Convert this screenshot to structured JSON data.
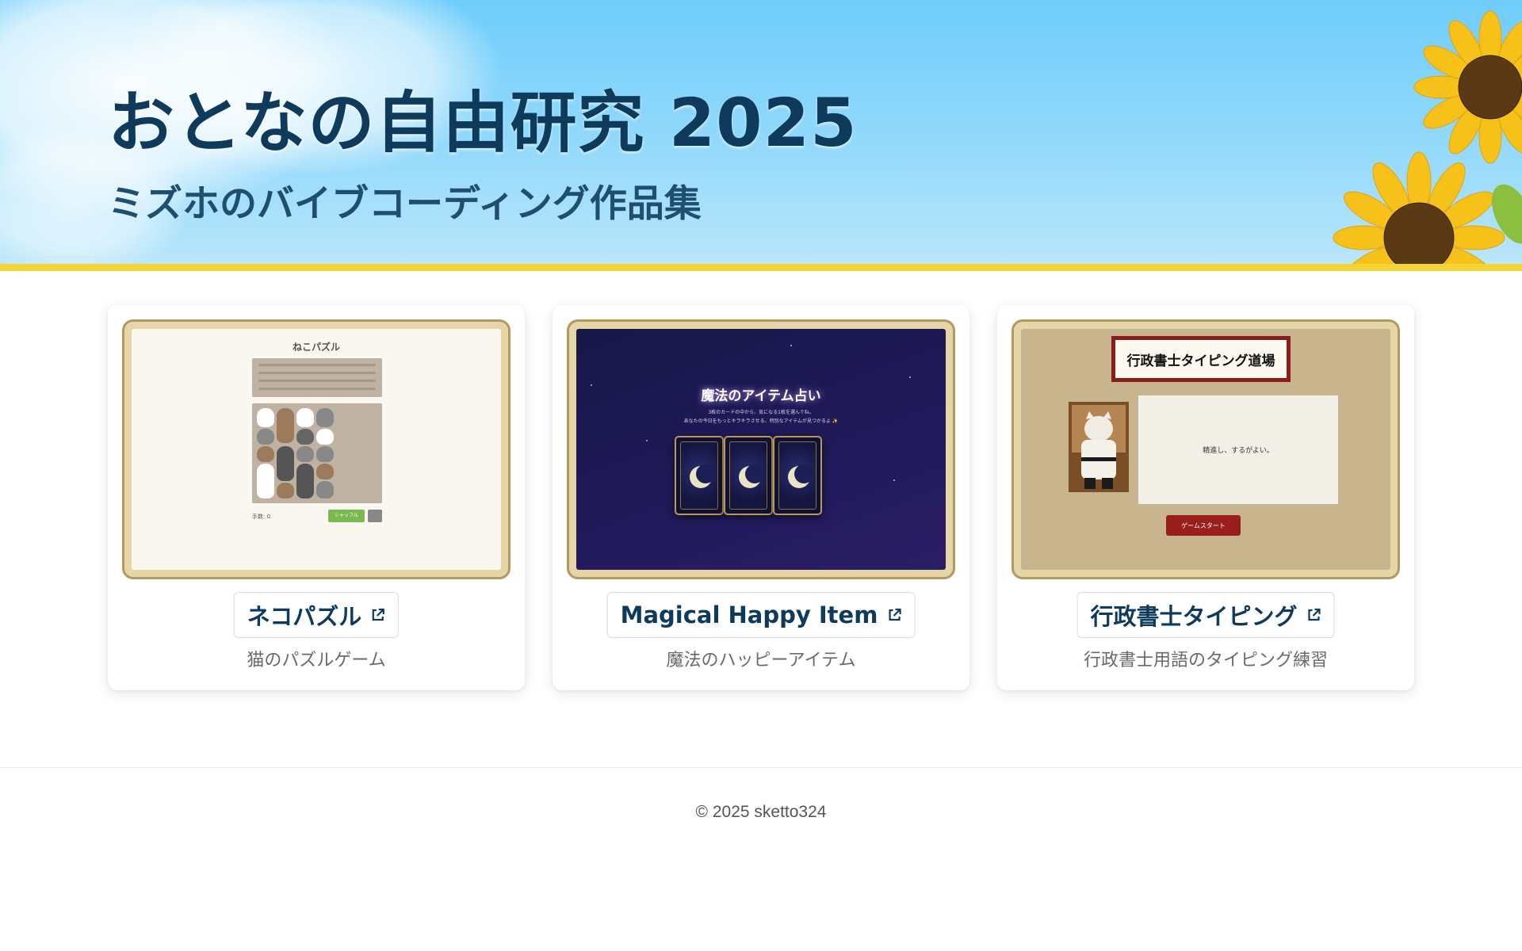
{
  "hero": {
    "title": "おとなの自由研究 2025",
    "subtitle": "ミズホのバイブコーディング作品集"
  },
  "colors": {
    "sky": "#7fd3fb",
    "stripe": "#f3d534",
    "title": "#0e3a5c",
    "frame": "#b09a62"
  },
  "cards": [
    {
      "label": "ネコパズル",
      "description": "猫のパズルゲーム",
      "icon": "external-link-icon",
      "preview": {
        "title": "ねこパズル",
        "moves_label": "手数: 0",
        "shuffle_label": "シャッフル"
      }
    },
    {
      "label": "Magical Happy Item",
      "description": "魔法のハッピーアイテム",
      "icon": "external-link-icon",
      "preview": {
        "title": "魔法のアイテム占い",
        "line1": "3枚のカードの中から、気になる1枚を選んでね。",
        "line2": "あなたの今日をもっとキラキラさせる、特別なアイテムが見つかるよ ✨"
      }
    },
    {
      "label": "行政書士タイピング",
      "description": "行政書士用語のタイピング練習",
      "icon": "external-link-icon",
      "preview": {
        "title": "行政書士タイピング道場",
        "message": "精進し、するがよい。",
        "start_label": "ゲームスタート"
      }
    }
  ],
  "footer": {
    "copyright": "© 2025 sketto324"
  }
}
